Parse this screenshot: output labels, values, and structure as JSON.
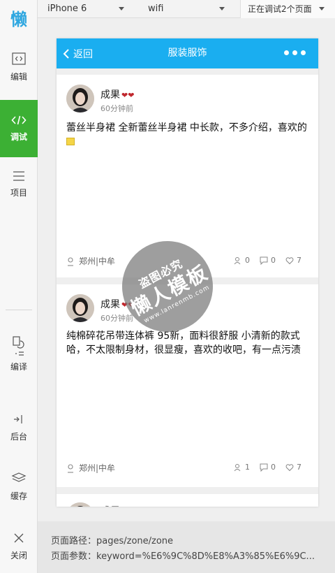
{
  "toolbar": {
    "device": "iPhone 6",
    "network": "wifi",
    "debug_status": "正在调试2个页面"
  },
  "sidebar": {
    "logo": "懒",
    "items": [
      {
        "label": "编辑",
        "icon": "code-file-icon"
      },
      {
        "label": "调试",
        "icon": "code-icon",
        "active": true
      },
      {
        "label": "项目",
        "icon": "menu-lines-icon"
      },
      {
        "label": "编译",
        "icon": "compile-icon"
      },
      {
        "label": "后台",
        "icon": "backend-icon"
      },
      {
        "label": "缓存",
        "icon": "layers-icon"
      },
      {
        "label": "关闭",
        "icon": "close-icon"
      }
    ]
  },
  "phone": {
    "nav": {
      "back_label": "返回",
      "title": "服装服饰"
    },
    "posts": [
      {
        "user": "成果",
        "time": "60分钟前",
        "content": "蕾丝半身裙 全新蕾丝半身裙 中长款，不多介绍，喜欢的",
        "location": "郑州|中牟",
        "views": "0",
        "comments": "0",
        "likes": "7"
      },
      {
        "user": "成果",
        "time": "60分钟前",
        "content": "纯棉碎花吊带连体裤 95新，面料很舒服 小清新的款式哈，不太限制身材，很显瘦，喜欢的收吧，有一点污渍",
        "location": "郑州|中牟",
        "views": "1",
        "comments": "0",
        "likes": "7"
      },
      {
        "user": "成果"
      }
    ]
  },
  "watermark": {
    "line1": "盗图必究",
    "line2": "懒人模板",
    "line3": "www.lanrenmb.com"
  },
  "footer": {
    "path_label": "页面路径：pages/zone/zone",
    "params_label": "页面参数：keyword=%E6%9C%8D%E8%A3%85%E6%9C..."
  },
  "colors": {
    "nav": "#1aaef0",
    "active": "#3cb034",
    "heart": "#c0272d"
  }
}
